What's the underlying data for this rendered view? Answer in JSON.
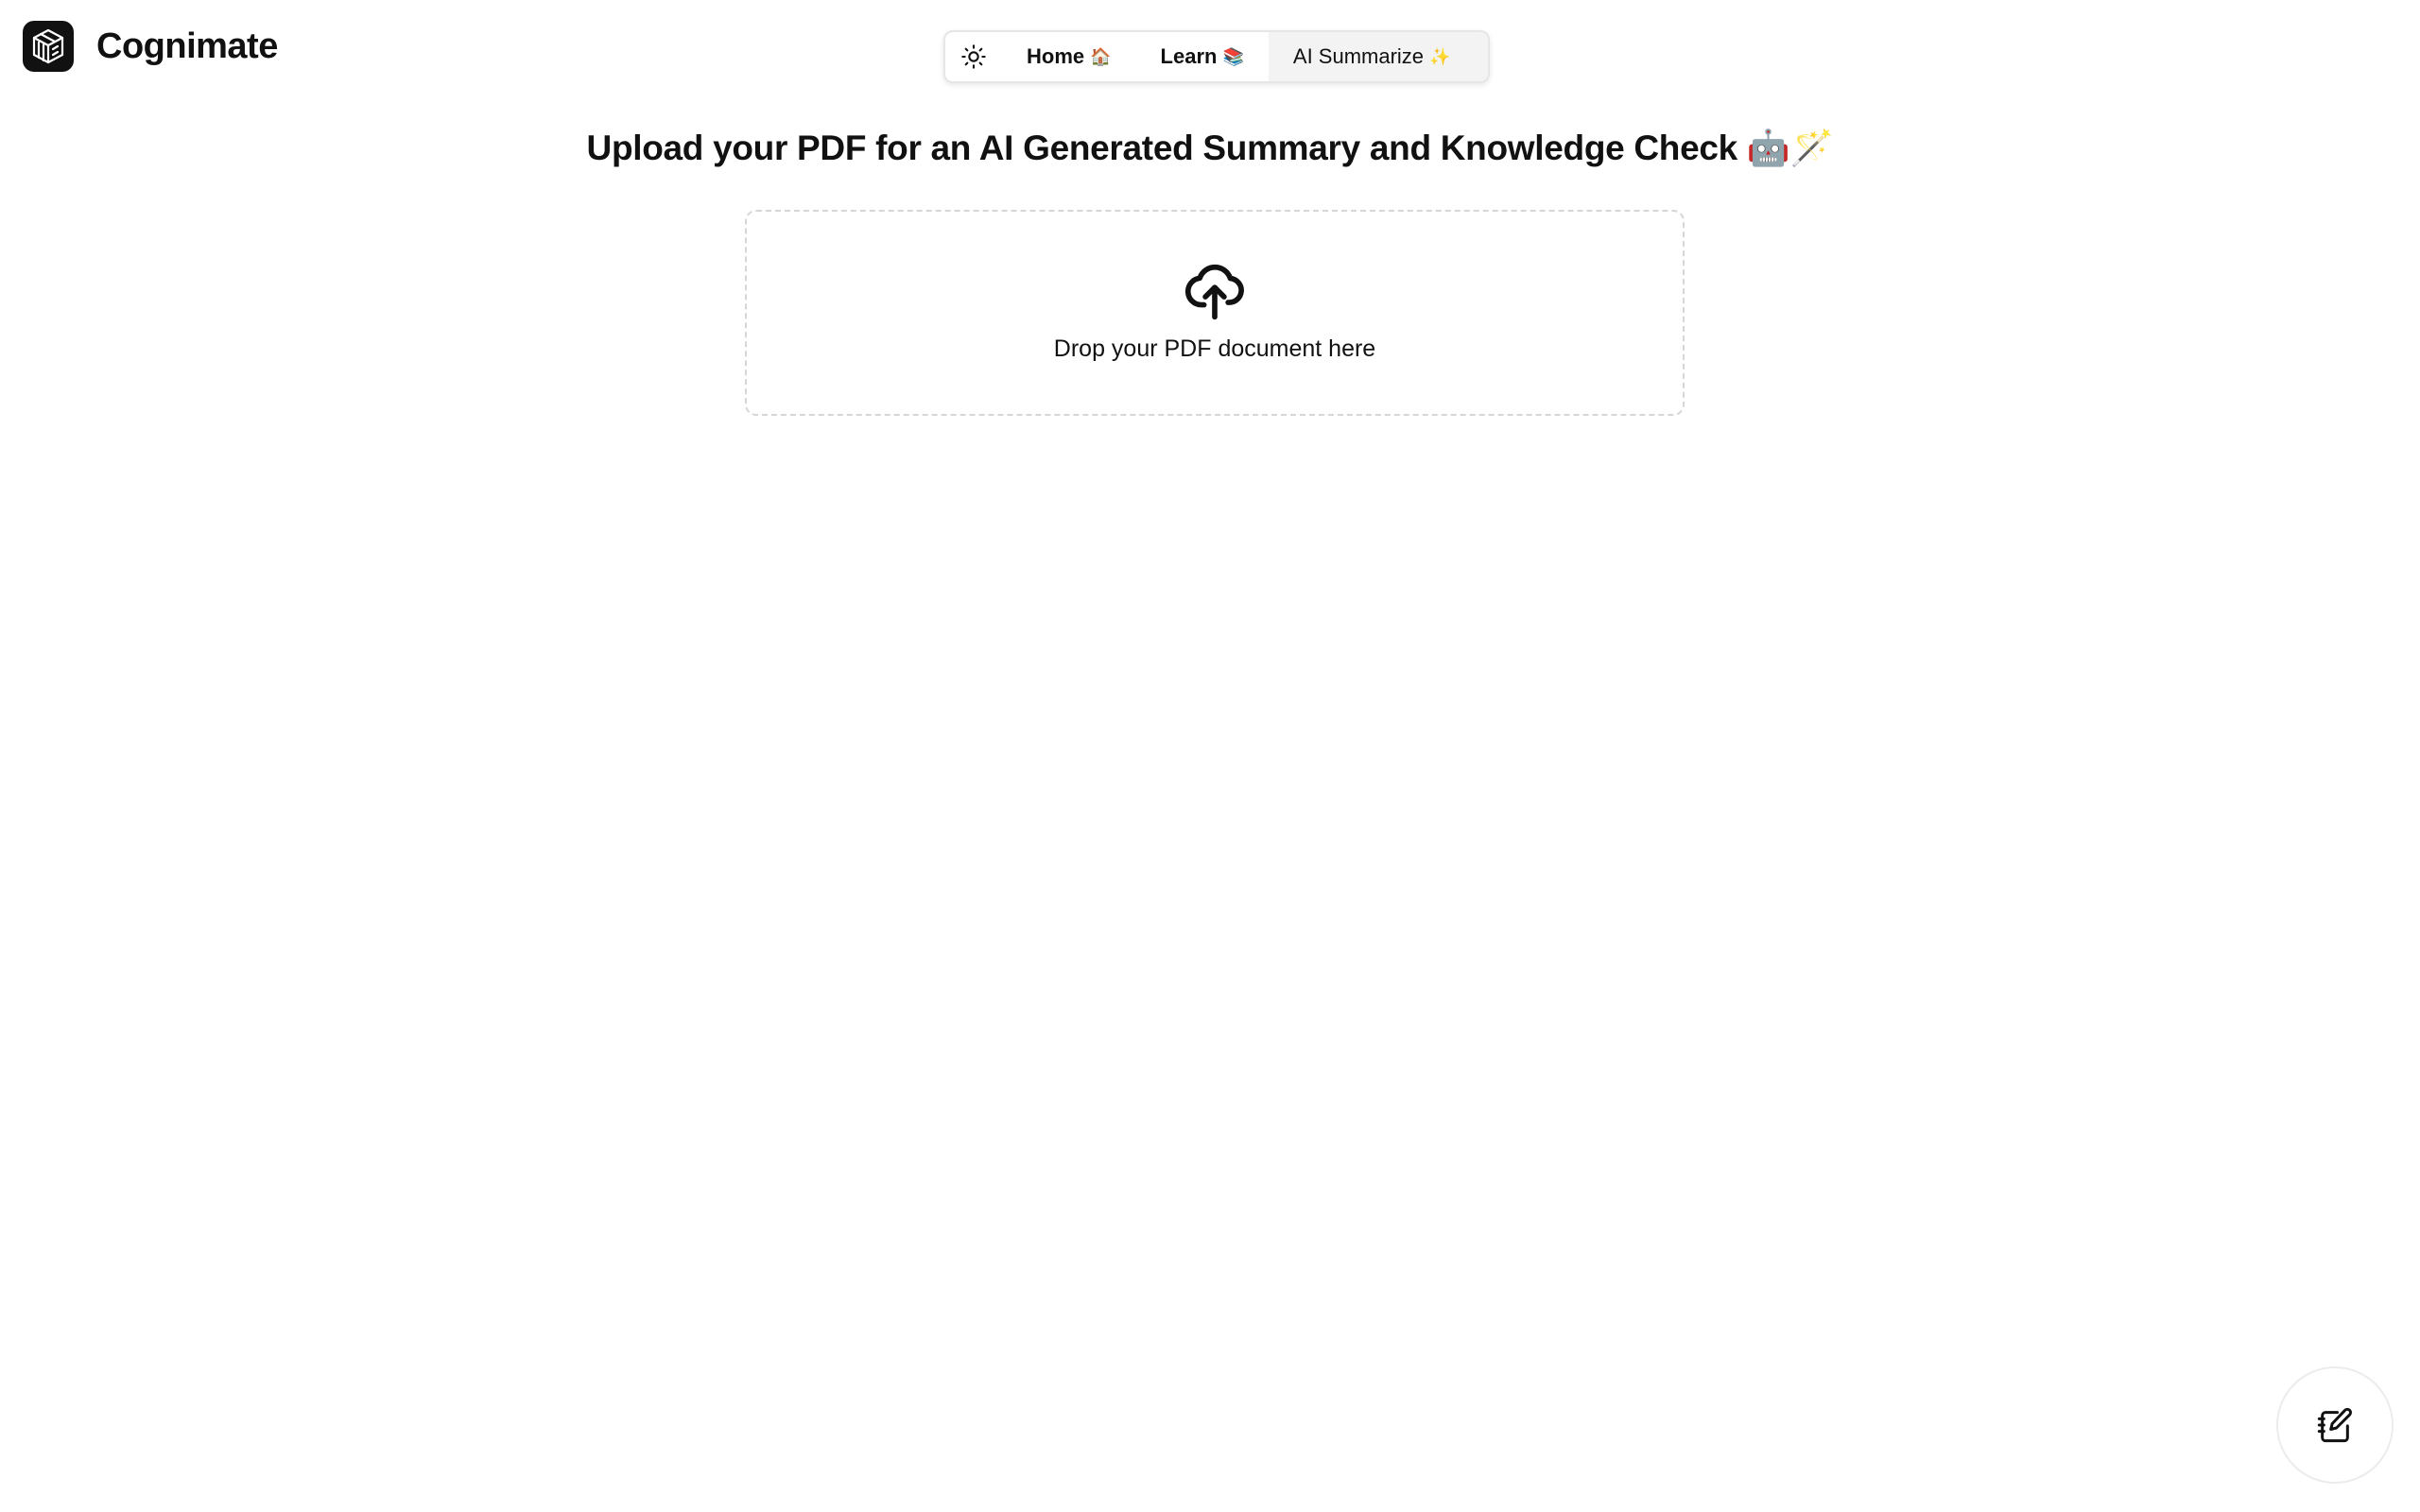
{
  "brand": {
    "name": "Cognimate",
    "logo_icon": "cube-logo-icon"
  },
  "nav": {
    "theme_toggle_icon": "sun-icon",
    "items": [
      {
        "label": "Home",
        "emoji": "🏠",
        "active": false
      },
      {
        "label": "Learn",
        "emoji": "📚",
        "active": false
      },
      {
        "label": "AI Summarize",
        "emoji": "✨",
        "active": true
      }
    ]
  },
  "main": {
    "title": "Upload your PDF for an AI Generated Summary and Knowledge Check 🤖🪄",
    "dropzone": {
      "icon": "cloud-upload-icon",
      "text": "Drop your PDF document here"
    }
  },
  "fab": {
    "icon": "notebook-edit-icon"
  },
  "colors": {
    "text": "#111111",
    "border": "#e6e6e6",
    "active_tab_bg": "#f3f3f3",
    "dropzone_border": "#d6d6d6"
  }
}
